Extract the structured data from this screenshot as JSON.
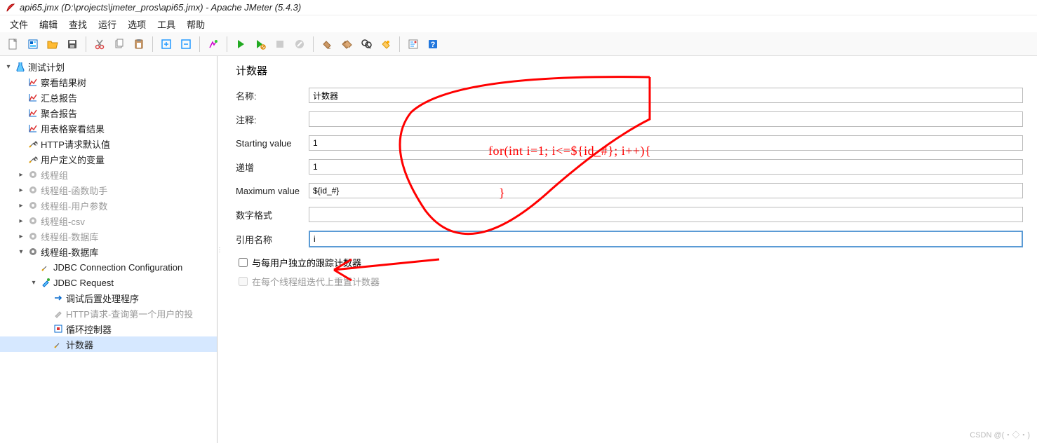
{
  "title": "api65.jmx (D:\\projects\\jmeter_pros\\api65.jmx) - Apache JMeter (5.4.3)",
  "menu": [
    "文件",
    "编辑",
    "查找",
    "运行",
    "选项",
    "工具",
    "帮助"
  ],
  "tree": {
    "root": "测试计划",
    "items": [
      {
        "label": "察看结果树",
        "icon": "chart"
      },
      {
        "label": "汇总报告",
        "icon": "chart"
      },
      {
        "label": "聚合报告",
        "icon": "chart"
      },
      {
        "label": "用表格察看结果",
        "icon": "chart"
      },
      {
        "label": "HTTP请求默认值",
        "icon": "wrench"
      },
      {
        "label": "用户定义的变量",
        "icon": "wrench"
      }
    ],
    "groups": [
      "线程组",
      "线程组-函数助手",
      "线程组-用户参数",
      "线程组-csv",
      "线程组-数据库"
    ],
    "dbgroup": {
      "label": "线程组-数据库",
      "children": [
        {
          "label": "JDBC Connection Configuration",
          "icon": "wrench"
        },
        {
          "label": "JDBC Request",
          "icon": "dropper",
          "children": [
            {
              "label": "调试后置处理程序",
              "icon": "arrow"
            },
            {
              "label": "HTTP请求-查询第一个用户的投",
              "icon": "dropper-dim"
            },
            {
              "label": "循环控制器",
              "icon": "loop"
            },
            {
              "label": "计数器",
              "icon": "wrench",
              "sel": true
            }
          ]
        }
      ]
    }
  },
  "panel": {
    "heading": "计数器",
    "fields": {
      "name_label": "名称:",
      "name_value": "计数器",
      "comment_label": "注释:",
      "comment_value": "",
      "start_label": "Starting value",
      "start_value": "1",
      "incr_label": "递增",
      "incr_value": "1",
      "max_label": "Maximum value",
      "max_value": "${id_#}",
      "fmt_label": "数字格式",
      "fmt_value": "",
      "ref_label": "引用名称",
      "ref_value": "i"
    },
    "chk1": "与每用户独立的跟踪计数器",
    "chk2": "在每个线程组迭代上重置计数器"
  },
  "annotation": "for(int i=1; i<=${id_#}; i++){",
  "annotation2": "}",
  "watermark": "CSDN @(・◇・)"
}
